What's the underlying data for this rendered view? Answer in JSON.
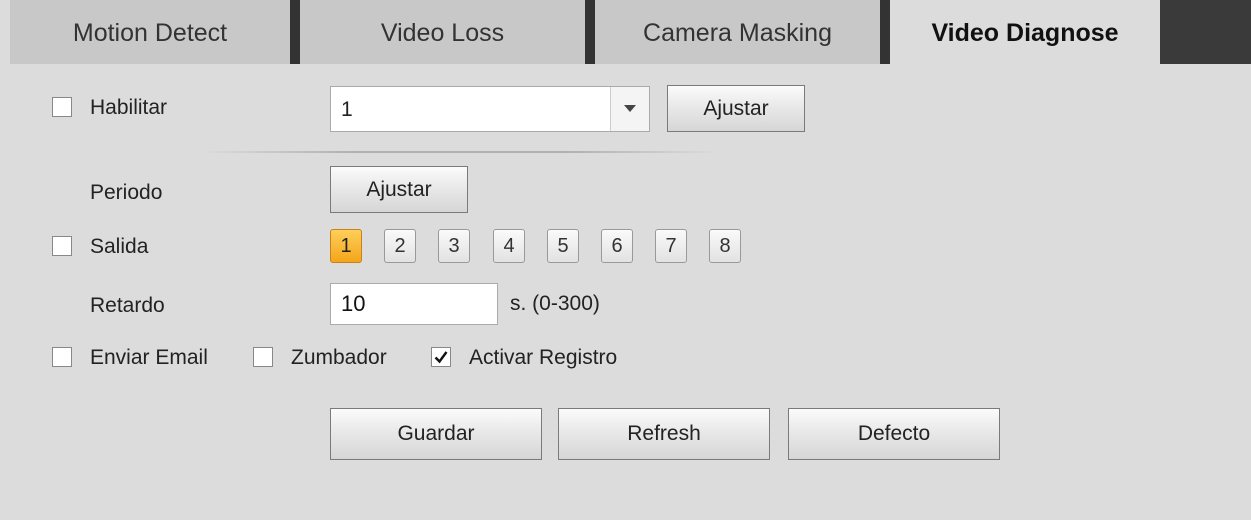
{
  "tabs": [
    {
      "label": "Motion Detect",
      "active": false
    },
    {
      "label": "Video Loss",
      "active": false
    },
    {
      "label": "Camera Masking",
      "active": false
    },
    {
      "label": "Video Diagnose",
      "active": true
    }
  ],
  "enable": {
    "label": "Habilitar",
    "checked": false
  },
  "select": {
    "value": "1",
    "icon": "chevron-down-icon"
  },
  "ajustar_label": "Ajustar",
  "periodo": {
    "label": "Periodo",
    "button": "Ajustar"
  },
  "salida": {
    "label": "Salida",
    "checked": false,
    "channels": [
      "1",
      "2",
      "3",
      "4",
      "5",
      "6",
      "7",
      "8"
    ],
    "selected": "1"
  },
  "retardo": {
    "label": "Retardo",
    "value": "10",
    "unit": "s. (0-300)"
  },
  "options": {
    "email": {
      "label": "Enviar Email",
      "checked": false
    },
    "buzzer": {
      "label": "Zumbador",
      "checked": false
    },
    "log": {
      "label": "Activar Registro",
      "checked": true
    }
  },
  "actions": {
    "save": "Guardar",
    "refresh": "Refresh",
    "default": "Defecto"
  },
  "colors": {
    "accent": "#f4a51a",
    "background": "#dcdcdc",
    "tab_border": "#333333"
  }
}
